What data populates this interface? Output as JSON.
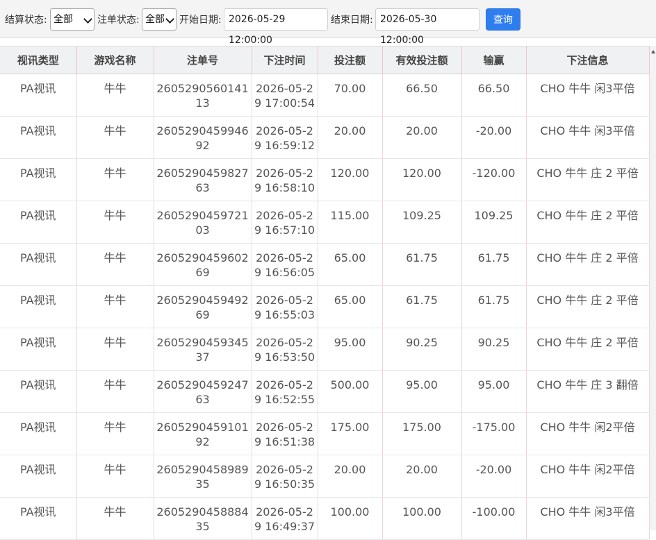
{
  "filters": {
    "settle_label": "结算状态:",
    "settle_value": "全部",
    "order_label": "注单状态:",
    "order_value": "全部",
    "start_label": "开始日期:",
    "start_value": "2026-05-29 12:00:00",
    "end_label": "结束日期:",
    "end_value": "2026-05-30 12:00:00",
    "query_label": "查询"
  },
  "table": {
    "headers": [
      "视讯类型",
      "游戏名称",
      "注单号",
      "下注时间",
      "投注额",
      "有效投注额",
      "输赢",
      "下注信息"
    ],
    "rows": [
      [
        "PA视讯",
        "牛牛",
        "260529056014113",
        "2026-05-29 17:00:54",
        "70.00",
        "66.50",
        "66.50",
        "CHO 牛牛 闲3平倍"
      ],
      [
        "PA视讯",
        "牛牛",
        "260529045994692",
        "2026-05-29 16:59:12",
        "20.00",
        "20.00",
        "-20.00",
        "CHO 牛牛 闲3平倍"
      ],
      [
        "PA视讯",
        "牛牛",
        "260529045982763",
        "2026-05-29 16:58:10",
        "120.00",
        "120.00",
        "-120.00",
        "CHO 牛牛 庄 2 平倍"
      ],
      [
        "PA视讯",
        "牛牛",
        "260529045972103",
        "2026-05-29 16:57:10",
        "115.00",
        "109.25",
        "109.25",
        "CHO 牛牛 庄 2 平倍"
      ],
      [
        "PA视讯",
        "牛牛",
        "260529045960269",
        "2026-05-29 16:56:05",
        "65.00",
        "61.75",
        "61.75",
        "CHO 牛牛 庄 2 平倍"
      ],
      [
        "PA视讯",
        "牛牛",
        "260529045949269",
        "2026-05-29 16:55:03",
        "65.00",
        "61.75",
        "61.75",
        "CHO 牛牛 庄 2 平倍"
      ],
      [
        "PA视讯",
        "牛牛",
        "260529045934537",
        "2026-05-29 16:53:50",
        "95.00",
        "90.25",
        "90.25",
        "CHO 牛牛 庄 2 平倍"
      ],
      [
        "PA视讯",
        "牛牛",
        "260529045924763",
        "2026-05-29 16:52:55",
        "500.00",
        "95.00",
        "95.00",
        "CHO 牛牛 庄 3 翻倍"
      ],
      [
        "PA视讯",
        "牛牛",
        "260529045910192",
        "2026-05-29 16:51:38",
        "175.00",
        "175.00",
        "-175.00",
        "CHO 牛牛 闲2平倍"
      ],
      [
        "PA视讯",
        "牛牛",
        "260529045898935",
        "2026-05-29 16:50:35",
        "20.00",
        "20.00",
        "-20.00",
        "CHO 牛牛 闲2平倍"
      ],
      [
        "PA视讯",
        "牛牛",
        "260529045888435",
        "2026-05-29 16:49:37",
        "100.00",
        "100.00",
        "-100.00",
        "CHO 牛牛 闲3平倍"
      ]
    ]
  }
}
